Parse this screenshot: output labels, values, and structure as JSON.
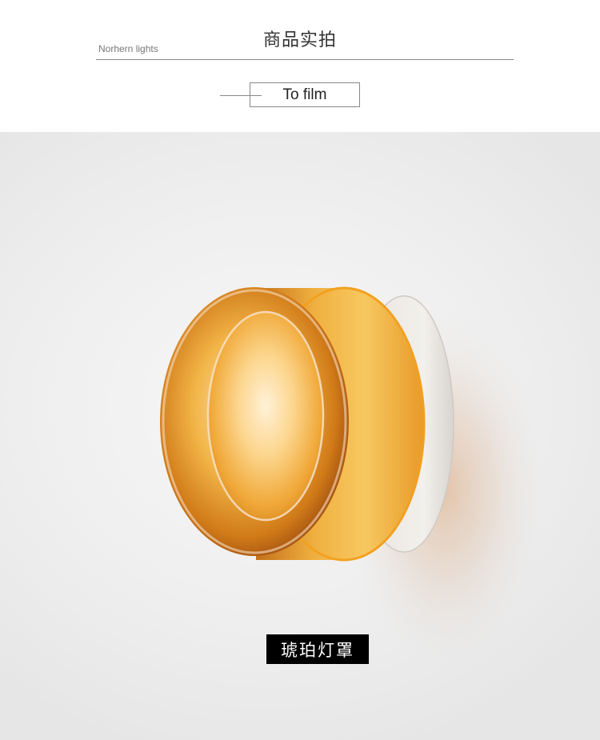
{
  "header": {
    "title": "商品实拍",
    "brand": "Norhern lights",
    "tag": "To film"
  },
  "photo": {
    "caption": "琥珀灯罩"
  },
  "colors": {
    "amber": "#e8a020",
    "background": "#efefef",
    "caption_bg": "#000000"
  }
}
